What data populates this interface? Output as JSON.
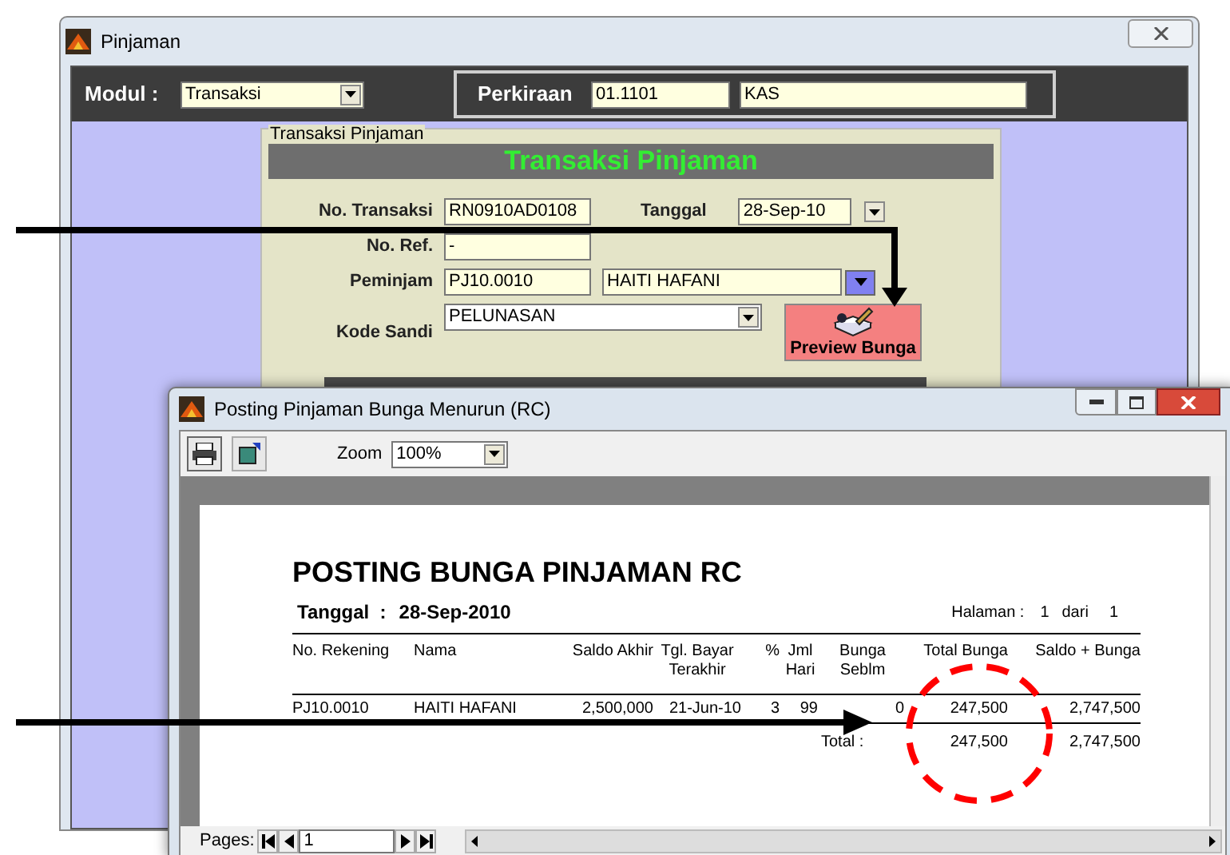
{
  "main_window": {
    "title": "Pinjaman",
    "modul": {
      "label": "Modul :",
      "value": "Transaksi"
    },
    "perkiraan": {
      "label": "Perkiraan",
      "code": "01.1101",
      "name": "KAS"
    },
    "form": {
      "group_title": "Transaksi Pinjaman",
      "heading": "Transaksi Pinjaman",
      "no_transaksi": {
        "label": "No. Transaksi",
        "value": "RN0910AD0108"
      },
      "tanggal": {
        "label": "Tanggal",
        "value": "28-Sep-10"
      },
      "no_ref": {
        "label": "No. Ref.",
        "value": "-"
      },
      "peminjam": {
        "label": "Peminjam",
        "code": "PJ10.0010",
        "name": "HAITI HAFANI"
      },
      "kode_sandi": {
        "label": "Kode Sandi",
        "value": "PELUNASAN"
      },
      "preview_button": "Preview Bunga"
    }
  },
  "preview_window": {
    "title": "Posting Pinjaman Bunga Menurun (RC)",
    "zoom": {
      "label": "Zoom",
      "value": "100%"
    },
    "report": {
      "title": "POSTING BUNGA PINJAMAN RC",
      "date_label": "Tanggal  :",
      "date": "28-Sep-2010",
      "page_label": "Halaman :",
      "page": "1",
      "of_label": "dari",
      "total_pages": "1",
      "columns": [
        "No. Rekening",
        "Nama",
        "Saldo Akhir",
        "Tgl. Bayar\nTerakhir",
        "%",
        "Jml\nHari",
        "Bunga\nSeblm",
        "Total Bunga",
        "Saldo + Bunga"
      ],
      "rows": [
        [
          "PJ10.0010",
          "HAITI HAFANI",
          "2,500,000",
          "21-Jun-10",
          "3",
          "99",
          "0",
          "247,500",
          "2,747,500"
        ]
      ],
      "total": {
        "label": "Total :",
        "values": [
          "247,500",
          "2,747,500"
        ]
      }
    },
    "pages": {
      "label": "Pages:",
      "value": "1"
    }
  }
}
